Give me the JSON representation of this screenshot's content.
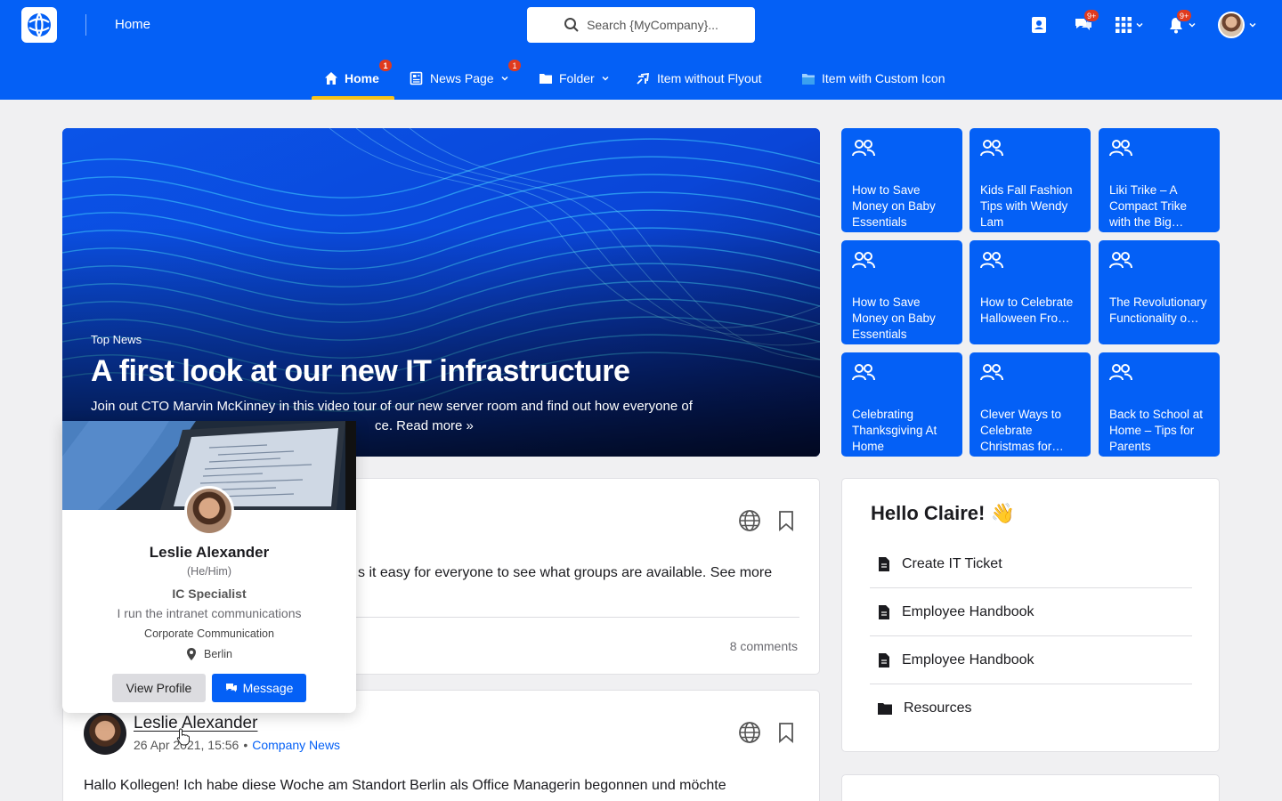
{
  "header": {
    "breadcrumb": "Home",
    "search_placeholder": "Search {MyCompany}...",
    "chat_badge": "9+",
    "notifications_badge": "9+",
    "brand_color": "#0460f6"
  },
  "nav": {
    "items": [
      {
        "label": "Home",
        "badge": "1",
        "icon": "home-icon"
      },
      {
        "label": "News Page",
        "badge": "1",
        "icon": "news-icon"
      },
      {
        "label": "Folder",
        "icon": "folder-icon"
      },
      {
        "label": "Item without Flyout",
        "icon": "plane-icon"
      },
      {
        "label": "Item with Custom Icon",
        "icon": "custom-icon"
      }
    ]
  },
  "hero": {
    "kicker": "Top News",
    "title": "A first look at our new IT infrastructure",
    "text": "Join out CTO Marvin McKinney in this video tour of our new server room and find out how everyone of",
    "text2": "ce. Read more »"
  },
  "tiles": [
    "How to Save Money on Baby Essentials",
    "Kids Fall Fashion Tips with Wendy Lam",
    "Liki Trike – A Compact Trike with the Big…",
    "How to Save Money on Baby Essentials",
    "How to Celebrate Halloween Fro…",
    "The Revolutionary Functionality o…",
    "Celebrating Thanksgiving At Home",
    "Clever Ways to Celebrate Christmas for…",
    "Back to School at Home – Tips for Parents"
  ],
  "post1": {
    "text": "s it easy for everyone to see what groups are available. See more",
    "comments": "8 comments"
  },
  "post2": {
    "author": "Leslie Alexander",
    "date": "26 Apr 2021, 15:56",
    "separator": "•",
    "channel": "Company News",
    "text": "Hallo Kollegen! Ich habe diese Woche am Standort Berlin als Office Managerin begonnen und möchte"
  },
  "hello": {
    "title": "Hello Claire! 👋",
    "links": [
      {
        "label": "Create IT Ticket",
        "icon": "document-icon"
      },
      {
        "label": "Employee Handbook",
        "icon": "document-icon"
      },
      {
        "label": "Employee Handbook",
        "icon": "document-icon"
      },
      {
        "label": "Resources",
        "icon": "folder-icon"
      }
    ]
  },
  "profile": {
    "name": "Leslie Alexander",
    "pronouns": "(He/Him)",
    "role": "IC Specialist",
    "bio": "I run the intranet communications",
    "department": "Corporate Communication",
    "location": "Berlin",
    "view_profile": "View Profile",
    "message": "Message"
  }
}
